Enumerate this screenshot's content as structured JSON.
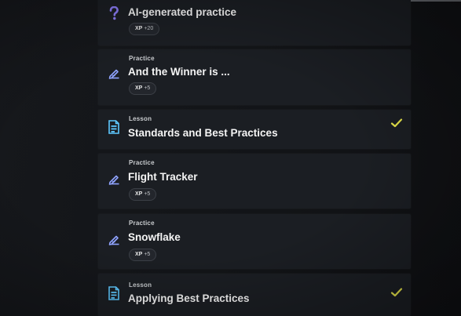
{
  "colors": {
    "background": "#131519",
    "card": "#1b1e23",
    "accent_question": "#8b7cf6",
    "accent_practice": "#8fa3ff",
    "accent_lesson": "#5ec8ff",
    "check": "#e6e44a"
  },
  "items": [
    {
      "kind": "question",
      "icon": "question-mark-icon",
      "type": "",
      "title": "AI-generated practice",
      "xp_label": "XP",
      "xp_value": "+20",
      "completed": false
    },
    {
      "kind": "practice",
      "icon": "pencil-edit-icon",
      "type": "Practice",
      "title": "And the Winner is ...",
      "xp_label": "XP",
      "xp_value": "+5",
      "completed": false
    },
    {
      "kind": "lesson",
      "icon": "document-icon",
      "type": "Lesson",
      "title": "Standards and Best Practices",
      "completed": true,
      "check_icon": "checkmark-icon"
    },
    {
      "kind": "practice",
      "icon": "pencil-edit-icon",
      "type": "Practice",
      "title": "Flight Tracker",
      "xp_label": "XP",
      "xp_value": "+5",
      "completed": false
    },
    {
      "kind": "practice",
      "icon": "pencil-edit-icon",
      "type": "Practice",
      "title": "Snowflake",
      "xp_label": "XP",
      "xp_value": "+5",
      "completed": false
    },
    {
      "kind": "lesson",
      "icon": "document-icon",
      "type": "Lesson",
      "title": "Applying Best Practices",
      "completed": true,
      "check_icon": "checkmark-icon"
    }
  ]
}
